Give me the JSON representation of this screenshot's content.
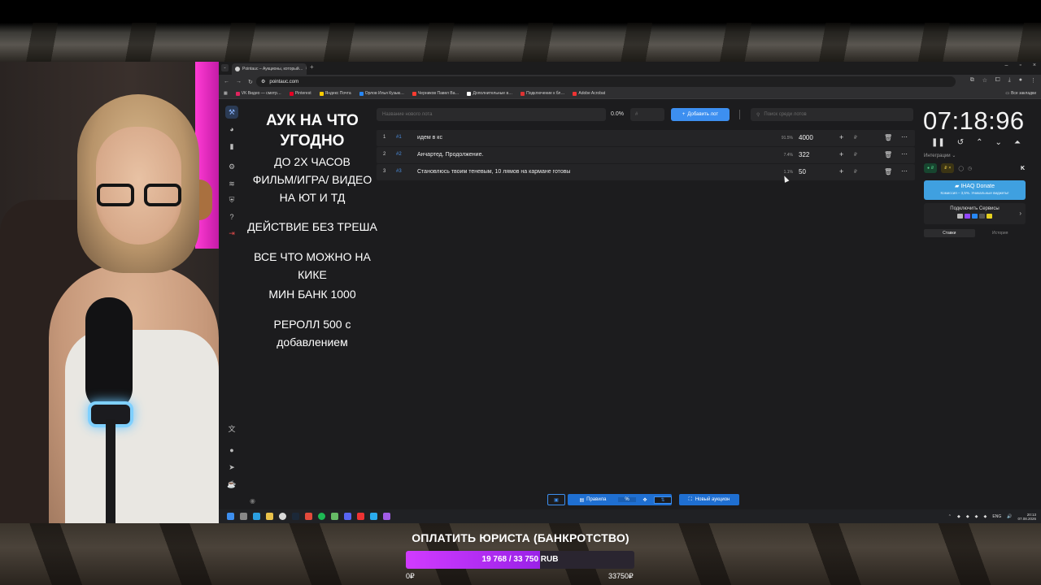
{
  "browser": {
    "tab_title": "Pointauc – Аукционы, который…",
    "url": "pointauc.com",
    "bookmarks": [
      {
        "label": "VK Видео — смотр…",
        "color": "#e0245e"
      },
      {
        "label": "Pinterest",
        "color": "#e60023"
      },
      {
        "label": "Яндекс Почта",
        "color": "#ffcc00"
      },
      {
        "label": "Орлов Илья Кузьм…",
        "color": "#2787f5"
      },
      {
        "label": "Черников Павел Ва…",
        "color": "#ff3b30"
      },
      {
        "label": "Дополнительные в…",
        "color": "#ffffff"
      },
      {
        "label": "Подключение к бл…",
        "color": "#d33"
      },
      {
        "label": "Adobe Acrobat",
        "color": "#e33"
      }
    ],
    "bookmarks_right": "Все закладки"
  },
  "rules": {
    "line1": "АУК НА ЧТО УГОДНО",
    "line2": "ДО 2Х ЧАСОВ",
    "line3": "ФИЛЬМ/ИГРА/ ВИДЕО НА ЮТ И ТД",
    "line4": "ДЕЙСТВИЕ БЕЗ ТРЕША",
    "line5": "ВСЕ ЧТО МОЖНО НА КИКЕ",
    "line6": "МИН БАНК 1000",
    "line7": "РЕРОЛЛ 500 с добавлением"
  },
  "controls": {
    "lot_placeholder": "Название нового лота",
    "percent": "0.0%",
    "hash_placeholder": "#",
    "add_label": "Добавить лот",
    "search_placeholder": "Поиск среди лотов"
  },
  "lots": [
    {
      "num": "1",
      "id": "#1",
      "name": "идем в кс",
      "pct": "91.5%",
      "amount": "4000"
    },
    {
      "num": "2",
      "id": "#2",
      "name": "Анчартед. Продолжение.",
      "pct": "7.4%",
      "amount": "322"
    },
    {
      "num": "3",
      "id": "#3",
      "name": "Становлюсь твоим теневым, 10 лямов на кармане готовы",
      "pct": "1.1%",
      "amount": "50"
    }
  ],
  "lot_currency": "₽",
  "timer": "07:18:96",
  "panel": {
    "integrations_label": "Интеграции",
    "pill1": "₽",
    "pill2": "₽",
    "kick": "K",
    "donate_title": "IHAQ Donate",
    "donate_sub": "Комиссия – 3,5%. Уникальные виджеты!",
    "services_label": "Подключить Сервисы",
    "tab_bids": "Ставки",
    "tab_history": "История"
  },
  "bottom": {
    "rules_label": "Правила",
    "percent_label": "%",
    "new_auction_label": "Новый аукцион"
  },
  "taskbar": {
    "lang": "ENG",
    "time": "20:13",
    "date": "07.08.2026"
  },
  "goal": {
    "title": "ОПЛАТИТЬ ЮРИСТА (БАНКРОТСТВО)",
    "progress_text": "19 768 / 33 750 RUB",
    "progress_fraction": 0.5857,
    "min": "0₽",
    "max": "33750₽"
  }
}
